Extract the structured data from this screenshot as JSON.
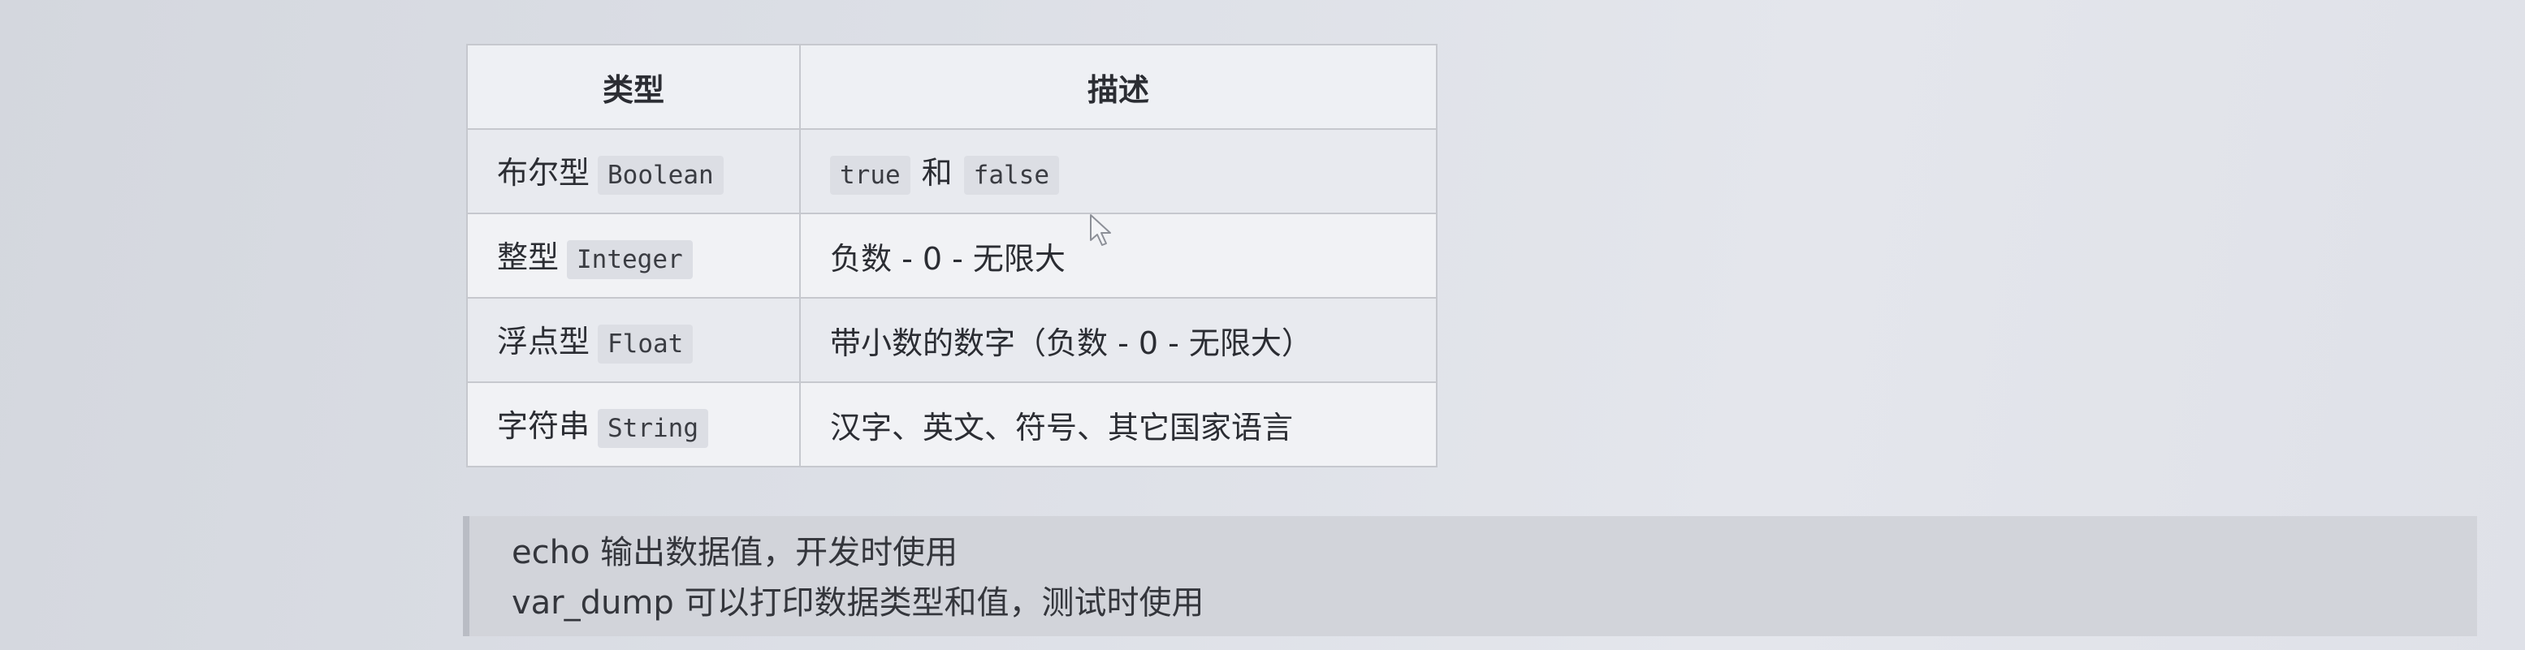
{
  "table": {
    "headers": [
      "类型",
      "描述"
    ],
    "rows": [
      {
        "type_cn": "布尔型",
        "type_code": "Boolean",
        "desc_parts": [
          "true",
          "和",
          "false"
        ]
      },
      {
        "type_cn": "整型",
        "type_code": "Integer",
        "desc": "负数 - 0 - 无限大"
      },
      {
        "type_cn": "浮点型",
        "type_code": "Float",
        "desc": "带小数的数字（负数 - 0 - 无限大）"
      },
      {
        "type_cn": "字符串",
        "type_code": "String",
        "desc": "汉字、英文、符号、其它国家语言"
      }
    ]
  },
  "notes": [
    "echo 输出数据值，开发时使用",
    "var_dump 可以打印数据类型和值，测试时使用"
  ],
  "icons": {
    "cursor": "mouse-pointer-icon"
  }
}
